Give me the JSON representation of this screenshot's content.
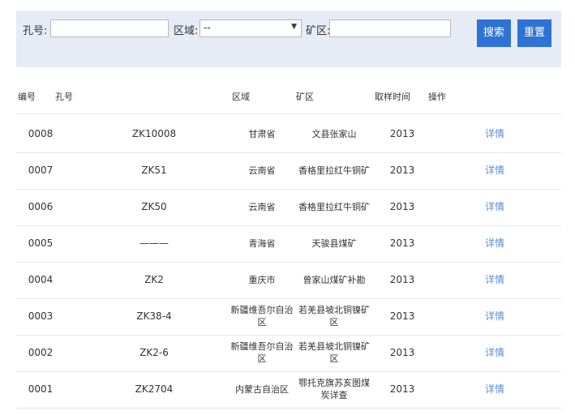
{
  "search": {
    "hole_label": "孔号:",
    "hole_value": "",
    "region_label": "区域:",
    "region_selected": "--",
    "mine_label": "矿区:",
    "mine_value": "",
    "search_button": "搜索",
    "reset_button": "重置"
  },
  "table": {
    "headers": [
      "编号",
      "孔号",
      "区域",
      "矿区",
      "取样时间",
      "操作"
    ],
    "rows": [
      {
        "id": "0008",
        "hole": "ZK10008",
        "region": "甘肃省",
        "mine": "文县张家山",
        "time": "2013",
        "action": "详情"
      },
      {
        "id": "0007",
        "hole": "ZK51",
        "region": "云南省",
        "mine": "香格里拉红牛铜矿",
        "time": "2013",
        "action": "详情"
      },
      {
        "id": "0006",
        "hole": "ZK50",
        "region": "云南省",
        "mine": "香格里拉红牛铜矿",
        "time": "2013",
        "action": "详情"
      },
      {
        "id": "0005",
        "hole": "———",
        "region": "青海省",
        "mine": "天骏县煤矿",
        "time": "2013",
        "action": "详情"
      },
      {
        "id": "0004",
        "hole": "ZK2",
        "region": "重庆市",
        "mine": "曾家山煤矿补勘",
        "time": "2013",
        "action": "详情"
      },
      {
        "id": "0003",
        "hole": "ZK38-4",
        "region": "新疆维吾尔自治区",
        "mine": "若羌县坡北铜镍矿区",
        "time": "2013",
        "action": "详情"
      },
      {
        "id": "0002",
        "hole": "ZK2-6",
        "region": "新疆维吾尔自治区",
        "mine": "若羌县坡北铜镍矿区",
        "time": "2013",
        "action": "详情"
      },
      {
        "id": "0001",
        "hole": "ZK2704",
        "region": "内蒙古自治区",
        "mine": "鄂托克旗苏亥图煤炭详查",
        "time": "2013",
        "action": "详情"
      }
    ]
  }
}
